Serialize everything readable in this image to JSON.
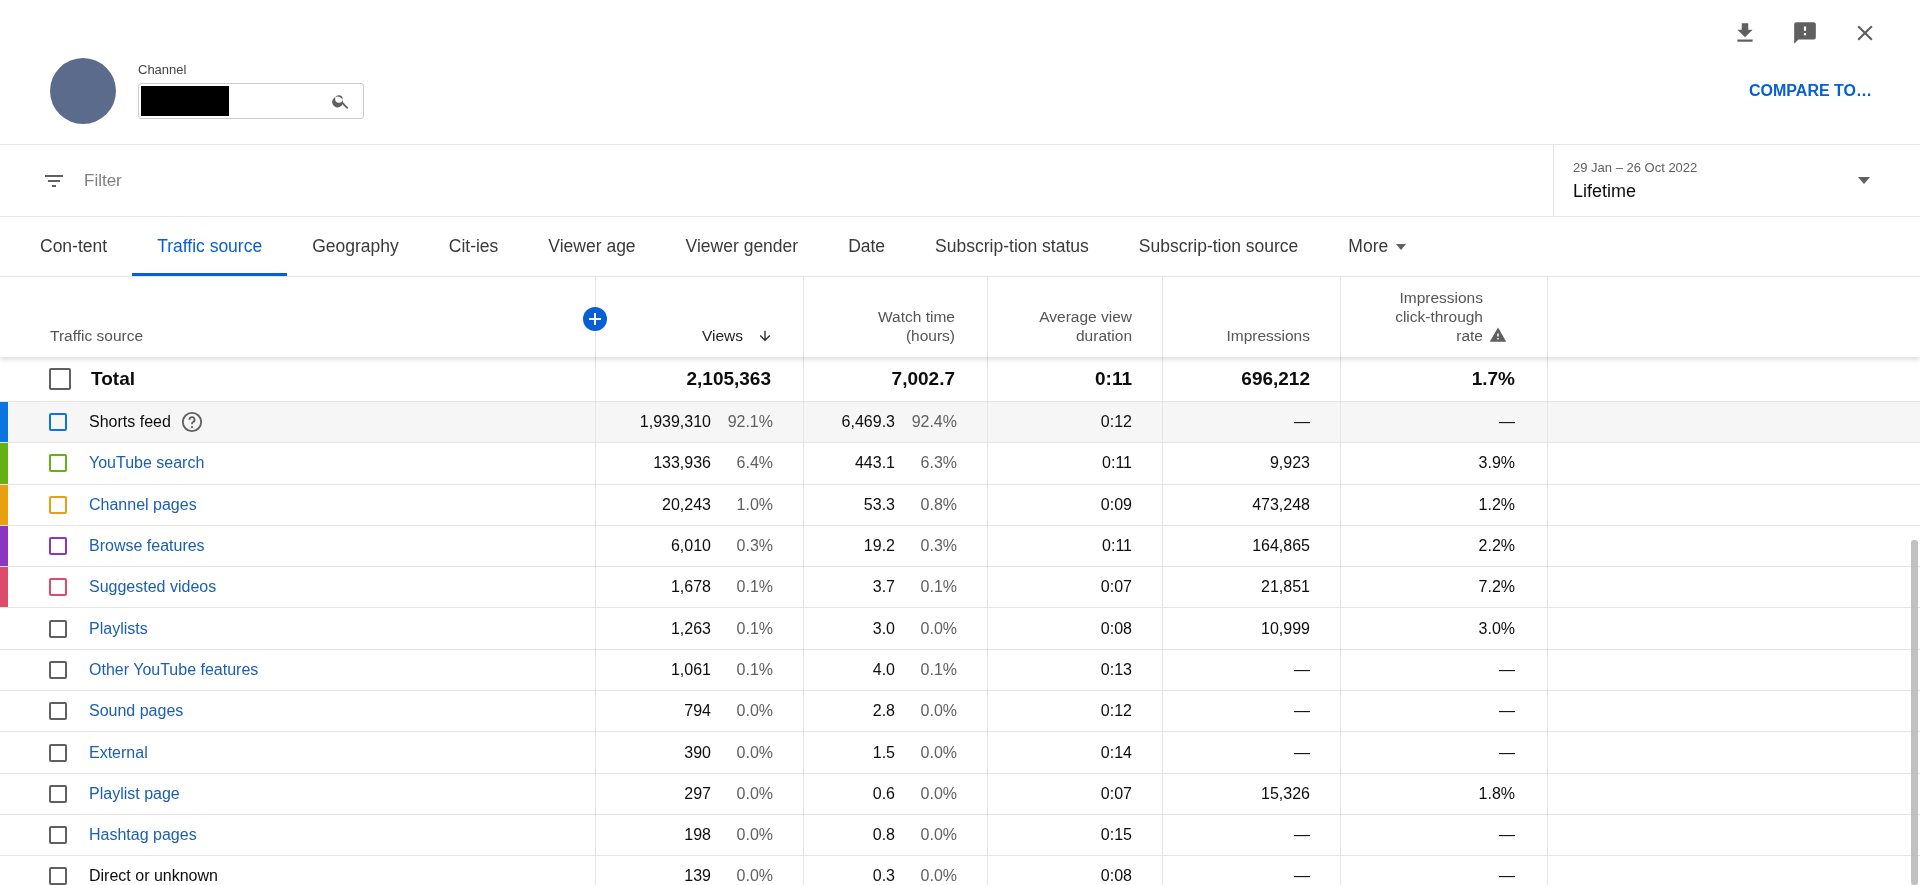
{
  "header": {
    "channel_label": "Channel",
    "compare_button": "COMPARE TO…"
  },
  "filter": {
    "placeholder": "Filter"
  },
  "date_range": {
    "range": "29 Jan – 26 Oct 2022",
    "period": "Lifetime"
  },
  "tabs": [
    {
      "label": "Con-tent",
      "selected": false,
      "kind": "tab"
    },
    {
      "label": "Traffic source",
      "selected": true,
      "kind": "tab"
    },
    {
      "label": "Geography",
      "selected": false,
      "kind": "tab"
    },
    {
      "label": "Cit-ies",
      "selected": false,
      "kind": "tab"
    },
    {
      "label": "Viewer age",
      "selected": false,
      "kind": "tab"
    },
    {
      "label": "Viewer gender",
      "selected": false,
      "kind": "tab"
    },
    {
      "label": "Date",
      "selected": false,
      "kind": "tab"
    },
    {
      "label": "Subscrip-tion status",
      "selected": false,
      "kind": "tab"
    },
    {
      "label": "Subscrip-tion source",
      "selected": false,
      "kind": "tab"
    },
    {
      "label": "More",
      "selected": false,
      "kind": "menu"
    }
  ],
  "table": {
    "columns": [
      {
        "label": "Traffic source",
        "sorted": false
      },
      {
        "label": "Views",
        "sorted": true
      },
      {
        "label": "Watch time (hours)",
        "sorted": false
      },
      {
        "label": "Average view duration",
        "sorted": false
      },
      {
        "label": "Impressions",
        "sorted": false
      },
      {
        "label": "Impressions click-through rate",
        "sorted": false,
        "warning": true
      }
    ],
    "total": {
      "label": "Total",
      "checked": false,
      "views": "2,105,363",
      "watch": "7,002.7",
      "avg": "0:11",
      "impressions": "696,212",
      "ctr": "1.7%"
    },
    "rows": [
      {
        "source": "Shorts feed",
        "link": false,
        "help": true,
        "color": "#0b74de",
        "highlighted": true,
        "checked": false,
        "views": "1,939,310",
        "views_pct": "92.1%",
        "watch": "6,469.3",
        "watch_pct": "92.4%",
        "avg": "0:12",
        "impressions": "—",
        "ctr": "—"
      },
      {
        "source": "YouTube search",
        "link": true,
        "color": "#65b012",
        "checked": false,
        "views": "133,936",
        "views_pct": "6.4%",
        "watch": "443.1",
        "watch_pct": "6.3%",
        "avg": "0:11",
        "impressions": "9,923",
        "ctr": "3.9%"
      },
      {
        "source": "Channel pages",
        "link": true,
        "color": "#e8a011",
        "checked": false,
        "views": "20,243",
        "views_pct": "1.0%",
        "watch": "53.3",
        "watch_pct": "0.8%",
        "avg": "0:09",
        "impressions": "473,248",
        "ctr": "1.2%"
      },
      {
        "source": "Browse features",
        "link": true,
        "color": "#8b36c1",
        "checked": false,
        "views": "6,010",
        "views_pct": "0.3%",
        "watch": "19.2",
        "watch_pct": "0.3%",
        "avg": "0:11",
        "impressions": "164,865",
        "ctr": "2.2%"
      },
      {
        "source": "Suggested videos",
        "link": true,
        "color": "#dc4b6a",
        "checked": false,
        "views": "1,678",
        "views_pct": "0.1%",
        "watch": "3.7",
        "watch_pct": "0.1%",
        "avg": "0:07",
        "impressions": "21,851",
        "ctr": "7.2%"
      },
      {
        "source": "Playlists",
        "link": true,
        "checked": false,
        "views": "1,263",
        "views_pct": "0.1%",
        "watch": "3.0",
        "watch_pct": "0.0%",
        "avg": "0:08",
        "impressions": "10,999",
        "ctr": "3.0%"
      },
      {
        "source": "Other YouTube features",
        "link": true,
        "checked": false,
        "views": "1,061",
        "views_pct": "0.1%",
        "watch": "4.0",
        "watch_pct": "0.1%",
        "avg": "0:13",
        "impressions": "—",
        "ctr": "—"
      },
      {
        "source": "Sound pages",
        "link": true,
        "checked": false,
        "views": "794",
        "views_pct": "0.0%",
        "watch": "2.8",
        "watch_pct": "0.0%",
        "avg": "0:12",
        "impressions": "—",
        "ctr": "—"
      },
      {
        "source": "External",
        "link": true,
        "checked": false,
        "views": "390",
        "views_pct": "0.0%",
        "watch": "1.5",
        "watch_pct": "0.0%",
        "avg": "0:14",
        "impressions": "—",
        "ctr": "—"
      },
      {
        "source": "Playlist page",
        "link": true,
        "checked": false,
        "views": "297",
        "views_pct": "0.0%",
        "watch": "0.6",
        "watch_pct": "0.0%",
        "avg": "0:07",
        "impressions": "15,326",
        "ctr": "1.8%"
      },
      {
        "source": "Hashtag pages",
        "link": true,
        "checked": false,
        "views": "198",
        "views_pct": "0.0%",
        "watch": "0.8",
        "watch_pct": "0.0%",
        "avg": "0:15",
        "impressions": "—",
        "ctr": "—"
      },
      {
        "source": "Direct or unknown",
        "link": false,
        "checked": false,
        "views": "139",
        "views_pct": "0.0%",
        "watch": "0.3",
        "watch_pct": "0.0%",
        "avg": "0:08",
        "impressions": "—",
        "ctr": "—"
      }
    ]
  }
}
